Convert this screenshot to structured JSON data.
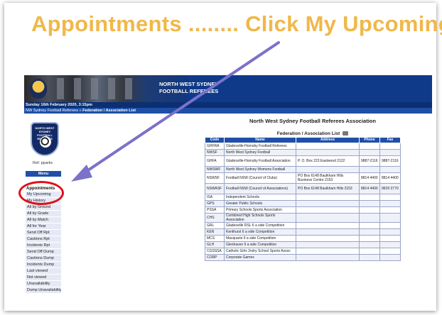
{
  "headline": "Appointments ........ Click My Upcoming",
  "brand": {
    "line1": "NORTH WEST SYDNEY",
    "line2": "FOOTBALL REFEREES"
  },
  "logo": {
    "line1": "NORTH WEST SYDNEY",
    "line2": "FOOTBALL REFEREES"
  },
  "datebar": "Sunday 16th February 2020, 3:15pm",
  "breadcrumb": {
    "site": "NW Sydney Football Referees",
    "sep": " » ",
    "page": "Federation / Association List"
  },
  "ref": "Ref: pparks",
  "menu": {
    "header": "Menu",
    "section": "Appointments",
    "items": [
      "My Upcoming",
      "My History",
      "All by Ground",
      "All by Grade",
      "All by Match",
      "All for Year",
      "Send Off Rpt",
      "Cautions Rpt",
      "Incidents Rpt",
      "Send Off Dump",
      "Cautions Dump",
      "Incidents Dump",
      "Last viewed",
      "Not viewed",
      "Unavailability",
      "Dump Unavailability"
    ]
  },
  "main": {
    "org_title": "North West Sydney Football Referees Association",
    "list_title": "Federation / Association List",
    "columns": [
      "Code",
      "Name",
      "Address",
      "Phone",
      "Fax"
    ],
    "rows": [
      {
        "code": "GHFRA",
        "name": "Gladesville-Hornsby Football Referees",
        "address": "",
        "phone": "",
        "fax": ""
      },
      {
        "code": "NWSF",
        "name": "North West Sydney Football",
        "address": "",
        "phone": "",
        "fax": ""
      },
      {
        "code": "GHFA",
        "name": "Gladesville-Hornsby Football Association",
        "address": "P. O. Box 223 Eastwood 2122",
        "phone": "9887-2116",
        "fax": "9887-2116"
      },
      {
        "code": "NWSWF",
        "name": "North West Sydney Womens Football",
        "address": "",
        "phone": "",
        "fax": ""
      },
      {
        "code": "NSWSF",
        "name": "Football NSW (Council of Clubs)",
        "address": "PO Box 6148 Baulkham Hills Business Centre 2153",
        "phone": "8814 4400",
        "fax": "8814 4400"
      },
      {
        "code": "NSWASF",
        "name": "Football NSW (Council of Associations)",
        "address": "PO Box 6148 Baulkham Hills 2153",
        "phone": "8814 4400",
        "fax": "9629 3770"
      },
      {
        "code": "ISA",
        "name": "Independent Schools",
        "address": "",
        "phone": "",
        "fax": ""
      },
      {
        "code": "GPS",
        "name": "Greater Public Schools",
        "address": "",
        "phone": "",
        "fax": ""
      },
      {
        "code": "PSSA",
        "name": "Primary Schools Sports Association",
        "address": "",
        "phone": "",
        "fax": ""
      },
      {
        "code": "CHS",
        "name": "Combined High Schools Sports Association",
        "address": "",
        "phone": "",
        "fax": ""
      },
      {
        "code": "GRL",
        "name": "Gladesville RSL 6 a side Competition",
        "address": "",
        "phone": "",
        "fax": ""
      },
      {
        "code": "KEN",
        "name": "Kenthurst 6 a side Competition",
        "address": "",
        "phone": "",
        "fax": ""
      },
      {
        "code": "MCS",
        "name": "Macquarie 6 a side Competition",
        "address": "",
        "phone": "",
        "fax": ""
      },
      {
        "code": "GLH",
        "name": "Glenhaven 6 a side Competition",
        "address": "",
        "phone": "",
        "fax": ""
      },
      {
        "code": "CGSSSA",
        "name": "Catholic Girls 2ndry School Sports Assoc",
        "address": "",
        "phone": "",
        "fax": ""
      },
      {
        "code": "CORP",
        "name": "Corporate Games",
        "address": "",
        "phone": "",
        "fax": ""
      }
    ]
  },
  "colors": {
    "headline": "#f0b84a",
    "banner": "#0f3a8a",
    "menu_header": "#1f4fa8",
    "highlight_circle": "#e0101a",
    "arrow": "#7b72c9"
  }
}
